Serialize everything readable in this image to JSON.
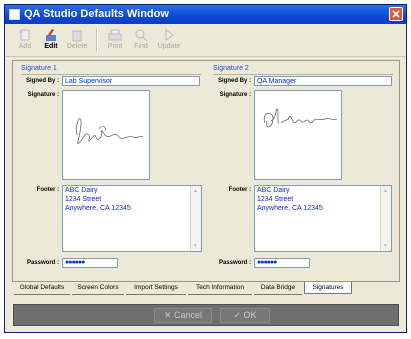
{
  "window": {
    "title": "QA Studio Defaults Window"
  },
  "toolbar": {
    "add": "Add",
    "edit": "Edit",
    "delete": "Delete",
    "print": "Print",
    "find": "Find",
    "update": "Update"
  },
  "signature1": {
    "header": "Signature 1",
    "signed_by_label": "Signed By :",
    "signed_by": "Lab Supervisor",
    "signature_label": "Signature :",
    "footer_label": "Footer :",
    "footer_lines": [
      "ABC Dairy",
      "1234 Street",
      "Anywhere, CA 12345"
    ],
    "password_label": "Password :",
    "password": "●●●●●●"
  },
  "signature2": {
    "header": "Signature 2",
    "signed_by_label": "Signed By :",
    "signed_by": "QA Manager",
    "signature_label": "Signature :",
    "footer_label": "Footer :",
    "footer_lines": [
      "ABC Dairy",
      "1234 Street",
      "Anywhere, CA 12345"
    ],
    "password_label": "Password :",
    "password": "●●●●●●"
  },
  "tabs": [
    "Global Defaults",
    "Screen Colors",
    "Import Settings",
    "Tech Information",
    "Data Bridge",
    "Signatures"
  ],
  "active_tab": "Signatures",
  "buttons": {
    "cancel": "Cancel",
    "ok": "OK"
  },
  "colors": {
    "title_bar": "#0a48d8",
    "field_text": "#0a2ccd",
    "group_header": "#1f4fb9"
  }
}
